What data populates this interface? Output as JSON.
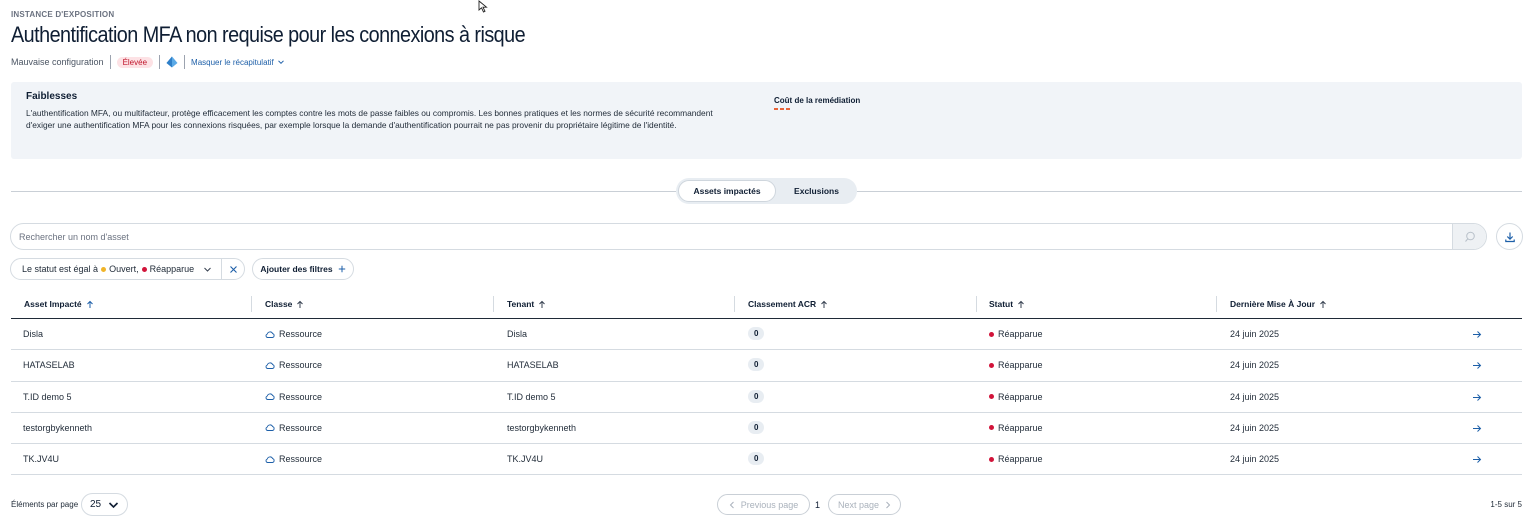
{
  "header": {
    "eyebrow": "INSTANCE D'EXPOSITION",
    "title": "Authentification MFA non requise pour les connexions à risque",
    "category": "Mauvaise configuration",
    "severity": "Élevée",
    "summary_toggle": "Masquer le récapitulatif"
  },
  "weakness": {
    "title": "Faiblesses",
    "description": "L'authentification MFA, ou multifacteur, protège efficacement les comptes contre les mots de passe faibles ou compromis. Les bonnes pratiques et les normes de sécurité recommandent d'exiger une authentification MFA pour les connexions risquées, par exemple lorsque la demande d'authentification pourrait ne pas provenir du propriétaire légitime de l'identité.",
    "cost_label": "Coût de la remédiation"
  },
  "tabs": {
    "impacted": "Assets impactés",
    "exclusions": "Exclusions"
  },
  "search": {
    "placeholder": "Rechercher un nom d'asset"
  },
  "filters": {
    "prefix": "Le statut est égal à",
    "value_open": "Ouvert,",
    "value_reappeared": "Réapparue",
    "add_label": "Ajouter des filtres"
  },
  "table": {
    "columns": [
      "Asset Impacté",
      "Classe",
      "Tenant",
      "Classement ACR",
      "Statut",
      "Dernière Mise À Jour"
    ],
    "rows": [
      {
        "asset": "Disla",
        "class": "Ressource",
        "tenant": "Disla",
        "acr": "0",
        "status": "Réapparue",
        "updated": "24 juin 2025"
      },
      {
        "asset": "HATASELAB",
        "class": "Ressource",
        "tenant": "HATASELAB",
        "acr": "0",
        "status": "Réapparue",
        "updated": "24 juin 2025"
      },
      {
        "asset": "T.ID demo 5",
        "class": "Ressource",
        "tenant": "T.ID demo 5",
        "acr": "0",
        "status": "Réapparue",
        "updated": "24 juin 2025"
      },
      {
        "asset": "testorgbykenneth",
        "class": "Ressource",
        "tenant": "testorgbykenneth",
        "acr": "0",
        "status": "Réapparue",
        "updated": "24 juin 2025"
      },
      {
        "asset": "TK.JV4U",
        "class": "Ressource",
        "tenant": "TK.JV4U",
        "acr": "0",
        "status": "Réapparue",
        "updated": "24 juin 2025"
      }
    ]
  },
  "pagination": {
    "per_page_label": "Éléments par page",
    "per_page_value": "25",
    "previous": "Previous page",
    "current": "1",
    "next": "Next page",
    "range": "1-5 sur 5"
  },
  "colors": {
    "severity_text": "#c0162c",
    "severity_bg": "#fde2e5",
    "status_open": "#f0b429",
    "status_reappeared": "#d1143a",
    "link": "#1d5fa8",
    "cost": "#e8643a"
  }
}
